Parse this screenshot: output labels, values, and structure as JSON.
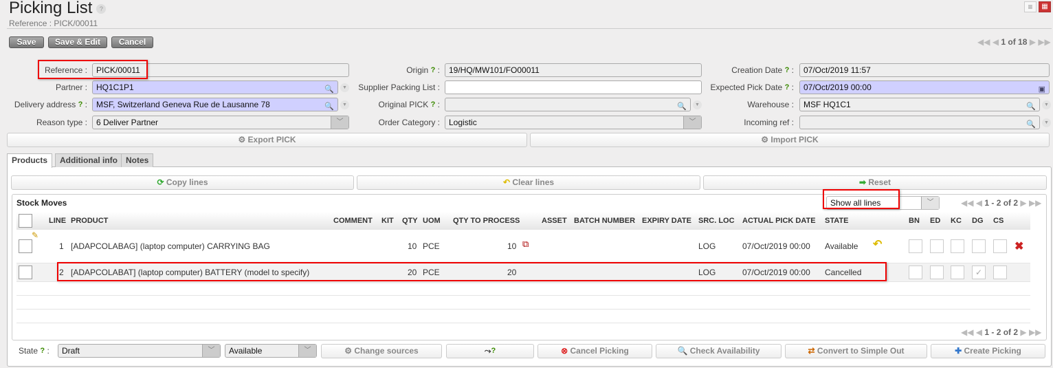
{
  "header": {
    "title": "Picking List",
    "subtitle": "Reference : PICK/00011",
    "help": "?"
  },
  "toolbar": {
    "save": "Save",
    "save_edit": "Save & Edit",
    "cancel": "Cancel",
    "pager": "1 of 18"
  },
  "form": {
    "reference": {
      "label": "Reference :",
      "value": "PICK/00011"
    },
    "partner": {
      "label": "Partner :",
      "value": "HQ1C1P1"
    },
    "delivery_address": {
      "label": "Delivery address",
      "value": "MSF, Switzerland Geneva Rue de Lausanne 78"
    },
    "reason_type": {
      "label": "Reason type :",
      "value": "6 Deliver Partner"
    },
    "origin": {
      "label": "Origin",
      "value": "19/HQ/MW101/FO00011"
    },
    "supplier_packing_list": {
      "label": "Supplier Packing List :",
      "value": ""
    },
    "original_pick": {
      "label": "Original PICK",
      "value": ""
    },
    "order_category": {
      "label": "Order Category :",
      "value": "Logistic"
    },
    "creation_date": {
      "label": "Creation Date",
      "value": "07/Oct/2019 11:57"
    },
    "expected_pick_date": {
      "label": "Expected Pick Date",
      "value": "07/Oct/2019 00:00"
    },
    "warehouse": {
      "label": "Warehouse :",
      "value": "MSF HQ1C1"
    },
    "incoming_ref": {
      "label": "Incoming ref :",
      "value": ""
    },
    "help": "?",
    "colon": ":"
  },
  "actions": {
    "export": "Export PICK",
    "import": "Import PICK"
  },
  "tabs": [
    "Products",
    "Additional info",
    "Notes"
  ],
  "products": {
    "copy": "Copy lines",
    "clear": "Clear lines",
    "reset": "Reset",
    "title": "Stock Moves",
    "filter": "Show all lines",
    "pager": "1 - 2 of 2",
    "columns": [
      "LINE",
      "PRODUCT",
      "COMMENT",
      "KIT",
      "QTY",
      "UOM",
      "QTY TO PROCESS",
      "ASSET",
      "BATCH NUMBER",
      "EXPIRY DATE",
      "SRC. LOC",
      "ACTUAL PICK DATE",
      "STATE",
      "BN",
      "ED",
      "KC",
      "DG",
      "CS"
    ],
    "rows": [
      {
        "line": "1",
        "product": "[ADAPCOLABAG] (laptop computer) CARRYING BAG",
        "qty": "10",
        "uom": "PCE",
        "qty_to_process": "10",
        "src": "LOG",
        "date": "07/Oct/2019 00:00",
        "state": "Available",
        "dg": false
      },
      {
        "line": "2",
        "product": "[ADAPCOLABAT] (laptop computer) BATTERY (model to specify)",
        "qty": "20",
        "uom": "PCE",
        "qty_to_process": "20",
        "src": "LOG",
        "date": "07/Oct/2019 00:00",
        "state": "Cancelled",
        "dg": true
      }
    ]
  },
  "footer": {
    "state_label": "State",
    "state": "Draft",
    "availability": "Available",
    "change_sources": "Change sources",
    "help": "?",
    "cancel_picking": "Cancel Picking",
    "check_availability": "Check Availability",
    "convert": "Convert to Simple Out",
    "create_picking": "Create Picking"
  },
  "colors": {
    "required_field": "#d0d0ff",
    "highlight": "#e00000",
    "help": "#3a8a00"
  }
}
